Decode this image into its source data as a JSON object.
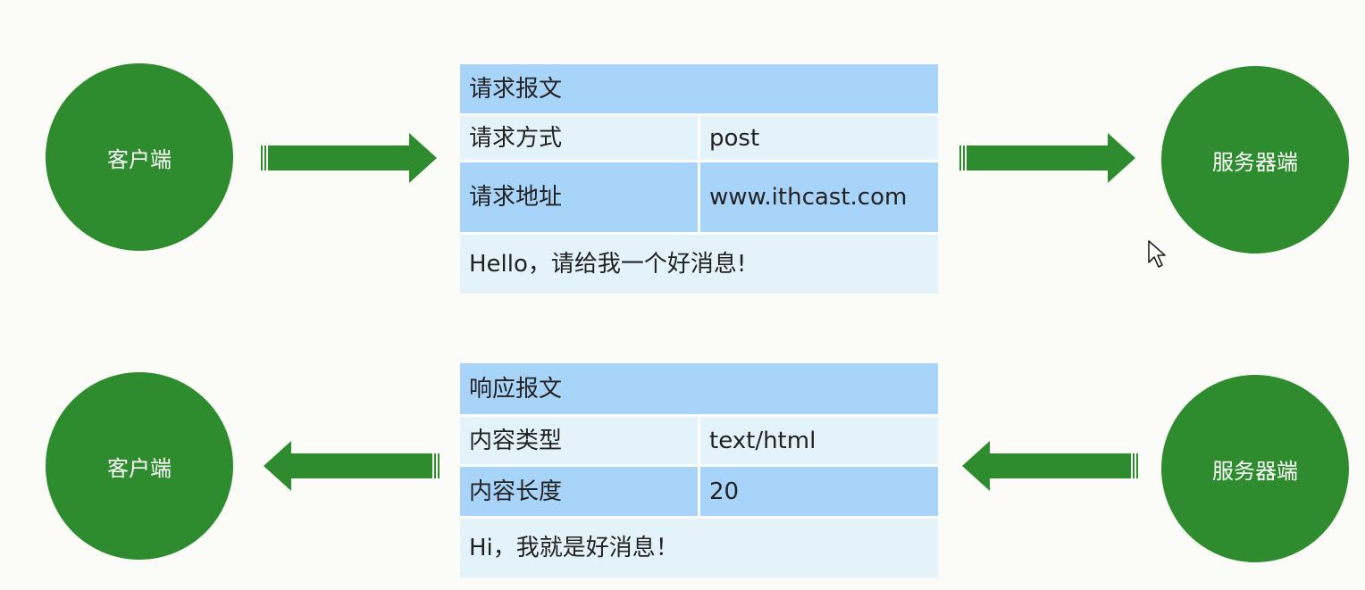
{
  "request": {
    "client_label": "客户端",
    "server_label": "服务器端",
    "title": "请求报文",
    "rows": [
      {
        "key": "请求方式",
        "value": "post"
      },
      {
        "key": "请求地址",
        "value": "www.ithcast.com"
      }
    ],
    "body": "Hello，请给我一个好消息!"
  },
  "response": {
    "client_label": "客户端",
    "server_label": "服务器端",
    "title": "响应报文",
    "rows": [
      {
        "key": "内容类型",
        "value": "text/html"
      },
      {
        "key": "内容长度",
        "value": "20"
      }
    ],
    "body": "Hi，我就是好消息！"
  },
  "colors": {
    "node": "#2e8b2e",
    "arrow": "#2e8b2e",
    "header_row": "#a9d4fa",
    "light_row": "#e4f2f9"
  },
  "icons": {
    "arrow_right": "arrow-right-icon",
    "arrow_left": "arrow-left-icon",
    "cursor": "mouse-cursor-icon"
  }
}
